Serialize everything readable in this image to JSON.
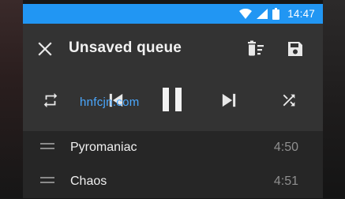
{
  "status_bar": {
    "time": "14:47",
    "icons": [
      "wifi-icon",
      "signal-icon",
      "battery-icon"
    ],
    "color": "#2196f3"
  },
  "toolbar": {
    "title": "Unsaved queue",
    "close_icon": "close-icon",
    "clear_icon": "clear-queue-icon",
    "save_icon": "save-icon"
  },
  "controls": {
    "repeat_icon": "repeat-icon",
    "prev_icon": "skip-previous-icon",
    "pause_icon": "pause-icon",
    "next_icon": "skip-next-icon",
    "shuffle_icon": "shuffle-icon"
  },
  "watermark": "hnfcjn.com",
  "tracks": [
    {
      "name": "Pyromaniac",
      "duration": "4:50"
    },
    {
      "name": "Chaos",
      "duration": "4:51"
    }
  ]
}
